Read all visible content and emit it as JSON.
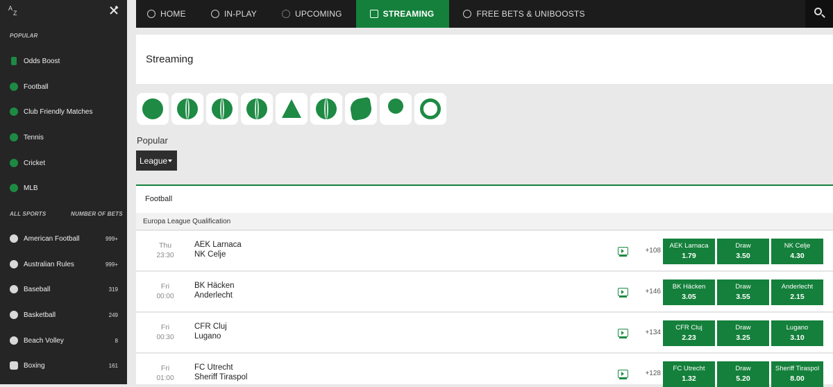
{
  "sidebar": {
    "popular_heading": "POPULAR",
    "all_sports_heading": "ALL SPORTS",
    "number_of_bets_heading": "NUMBER OF BETS",
    "popular_items": [
      {
        "label": "Odds Boost",
        "icon": "odds-boost-icon"
      },
      {
        "label": "Football",
        "icon": "football-icon"
      },
      {
        "label": "Club Friendly Matches",
        "icon": "football-icon"
      },
      {
        "label": "Tennis",
        "icon": "tennis-icon"
      },
      {
        "label": "Cricket",
        "icon": "cricket-icon"
      },
      {
        "label": "MLB",
        "icon": "baseball-icon"
      }
    ],
    "sports": [
      {
        "label": "American Football",
        "count": "999+",
        "icon": "american-football-icon"
      },
      {
        "label": "Australian Rules",
        "count": "999+",
        "icon": "australian-rules-icon"
      },
      {
        "label": "Baseball",
        "count": "319",
        "icon": "baseball-icon"
      },
      {
        "label": "Basketball",
        "count": "249",
        "icon": "basketball-icon"
      },
      {
        "label": "Beach Volley",
        "count": "8",
        "icon": "volleyball-icon"
      },
      {
        "label": "Boxing",
        "count": "161",
        "icon": "boxing-glove-icon"
      }
    ]
  },
  "nav": {
    "items": [
      {
        "label": "HOME",
        "icon": "home-icon",
        "active": false
      },
      {
        "label": "IN-PLAY",
        "icon": "clock-icon",
        "active": false
      },
      {
        "label": "UPCOMING",
        "icon": "upcoming-icon",
        "active": false
      },
      {
        "label": "STREAMING",
        "icon": "tv-icon",
        "active": true
      },
      {
        "label": "FREE BETS & UNIBOOSTS",
        "icon": "circle-icon",
        "active": false
      }
    ]
  },
  "page": {
    "title": "Streaming",
    "popular_label": "Popular",
    "league_dropdown": "League",
    "sport_filters": [
      "football-icon",
      "tennis-icon",
      "basketball-icon",
      "cricket-icon",
      "snooker-icon",
      "darts-icon",
      "rugby-icon",
      "table-tennis-icon",
      "tennis-ball-icon"
    ]
  },
  "section": {
    "sport": "Football",
    "league": "Europa League Qualification"
  },
  "matches": [
    {
      "day": "Thu",
      "time": "23:30",
      "home": "AEK Larnaca",
      "away": "NK Celje",
      "more": "+108",
      "odds": [
        {
          "label": "AEK Larnaca",
          "value": "1.79"
        },
        {
          "label": "Draw",
          "value": "3.50"
        },
        {
          "label": "NK Celje",
          "value": "4.30"
        }
      ]
    },
    {
      "day": "Fri",
      "time": "00:00",
      "home": "BK Häcken",
      "away": "Anderlecht",
      "more": "+146",
      "odds": [
        {
          "label": "BK Häcken",
          "value": "3.05"
        },
        {
          "label": "Draw",
          "value": "3.55"
        },
        {
          "label": "Anderlecht",
          "value": "2.15"
        }
      ]
    },
    {
      "day": "Fri",
      "time": "00:30",
      "home": "CFR Cluj",
      "away": "Lugano",
      "more": "+134",
      "odds": [
        {
          "label": "CFR Cluj",
          "value": "2.23"
        },
        {
          "label": "Draw",
          "value": "3.25"
        },
        {
          "label": "Lugano",
          "value": "3.10"
        }
      ]
    },
    {
      "day": "Fri",
      "time": "01:00",
      "home": "FC Utrecht",
      "away": "Sheriff Tiraspol",
      "more": "+128",
      "odds": [
        {
          "label": "FC Utrecht",
          "value": "1.32"
        },
        {
          "label": "Draw",
          "value": "5.20"
        },
        {
          "label": "Sheriff Tiraspol",
          "value": "8.00"
        }
      ]
    }
  ],
  "colors": {
    "accent": "#14803b",
    "sidebar_bg": "#252525",
    "nav_bg": "#1c1c1c"
  }
}
